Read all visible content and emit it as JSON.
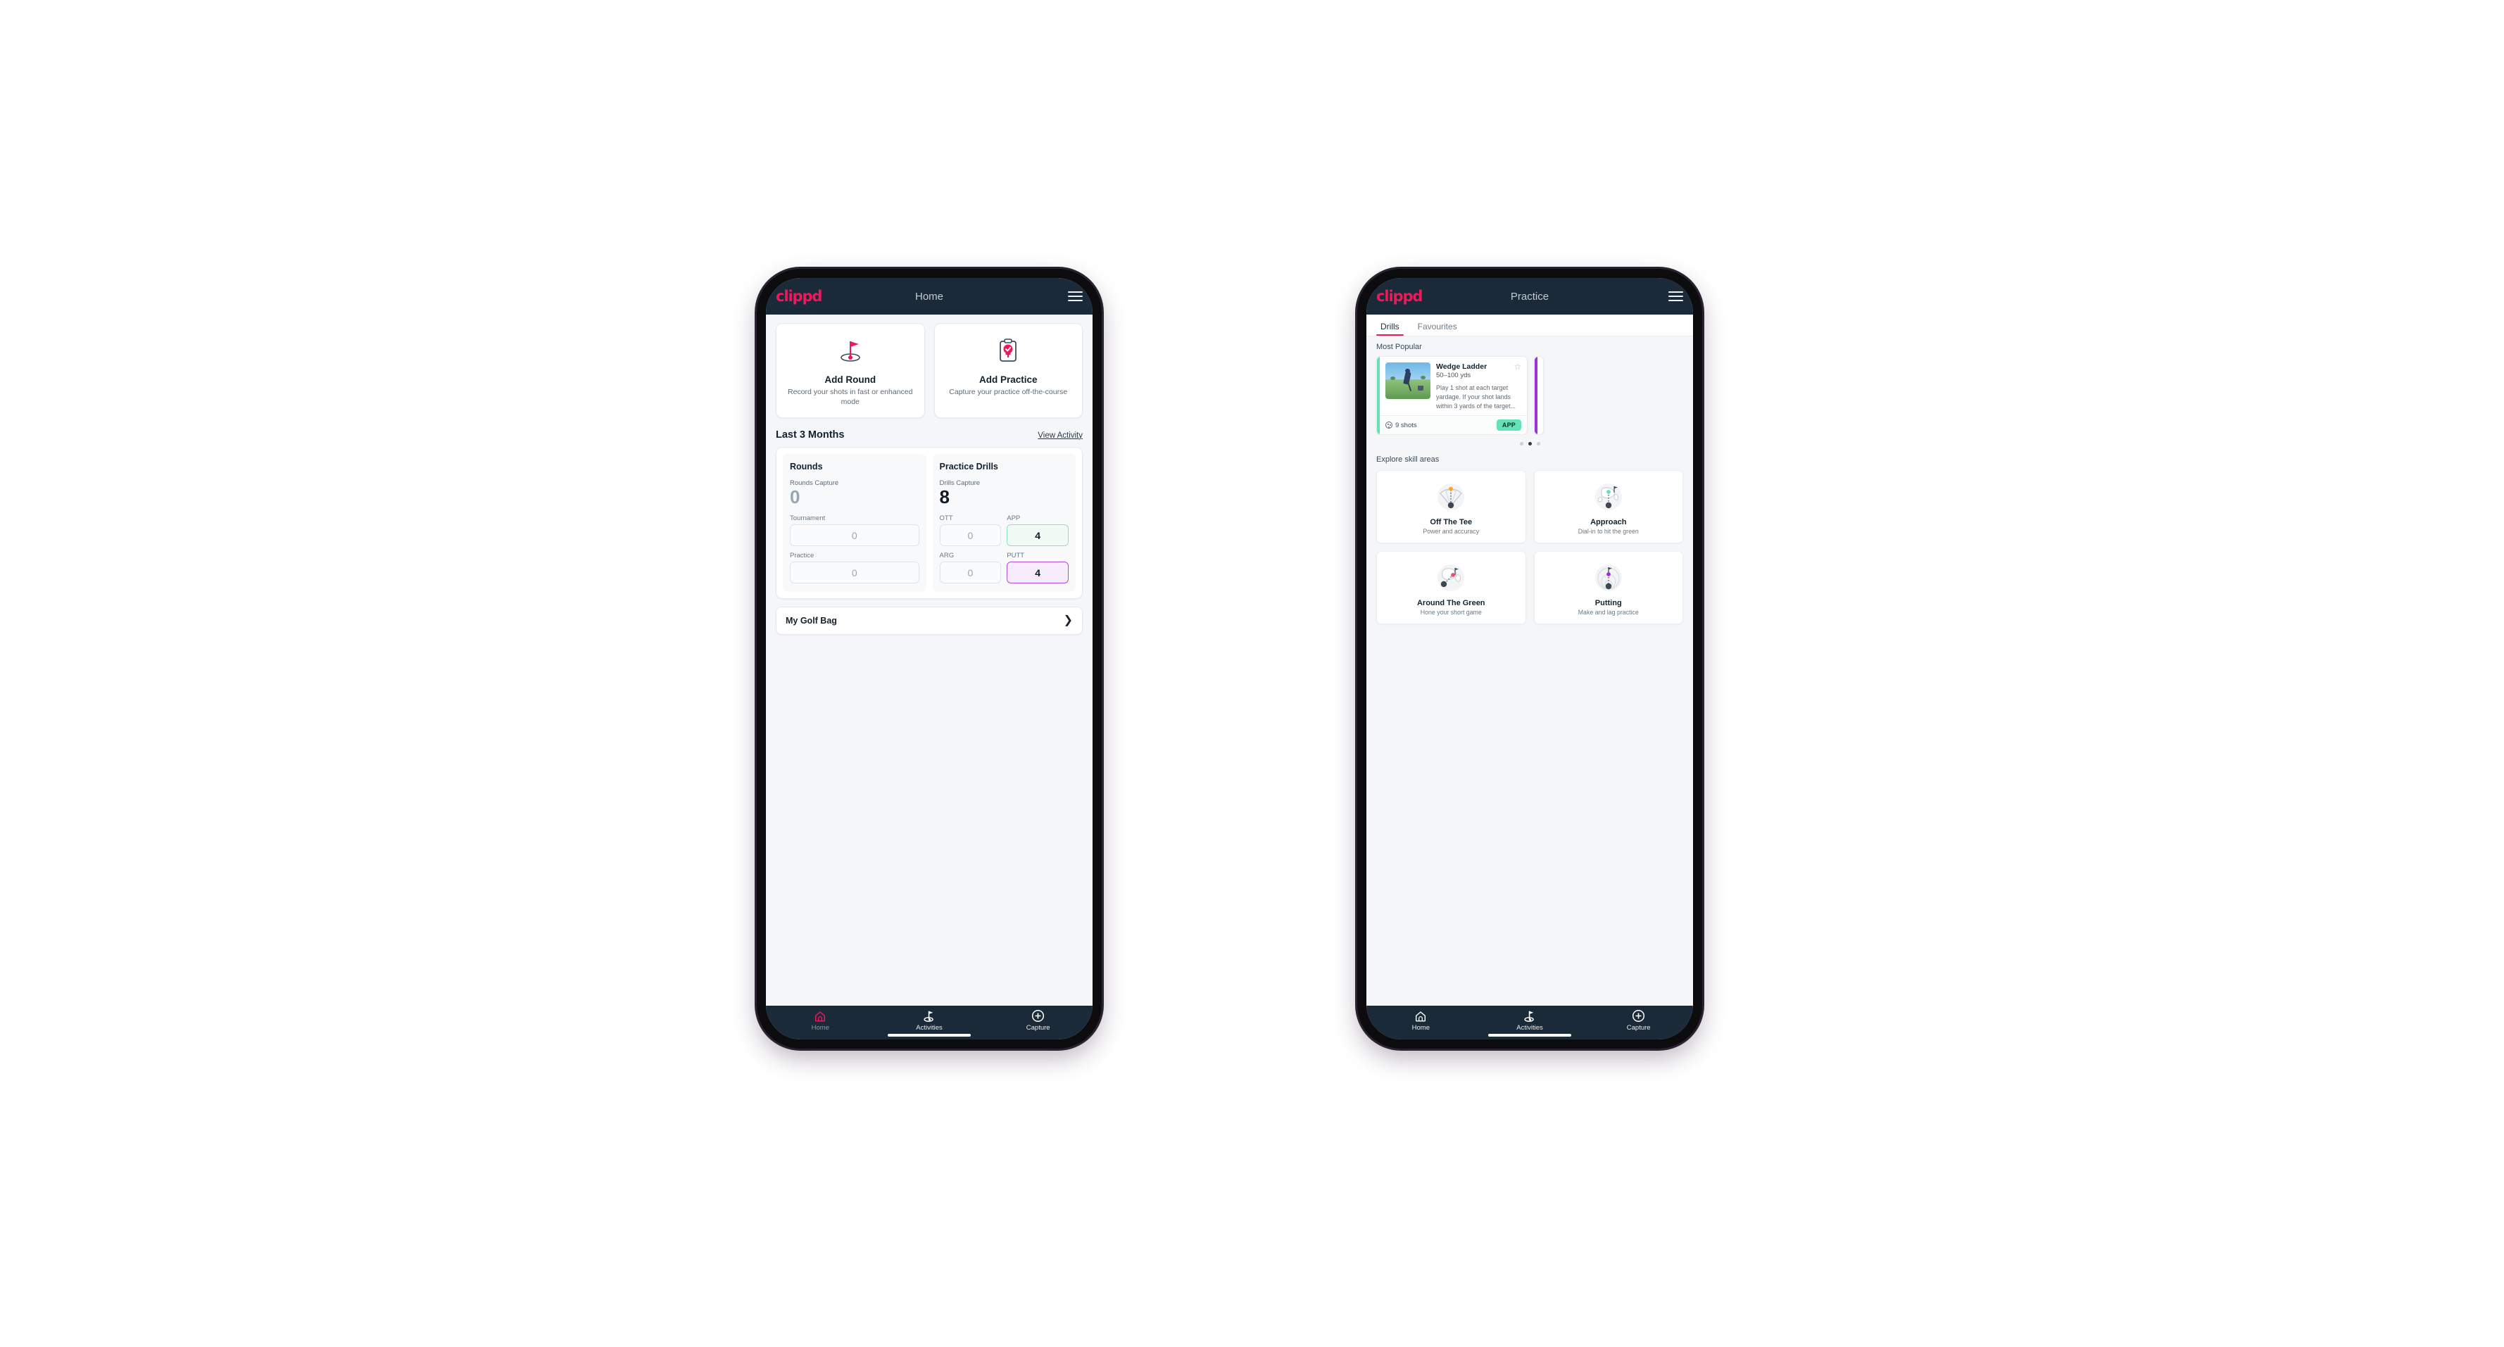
{
  "brand": {
    "logo_text": "clippd",
    "accent_pink": "#ed1a5b",
    "header_navy": "#1b2a38",
    "accent_green": "#63e2b7",
    "accent_purple": "#a32fdb"
  },
  "phone_home": {
    "appbar": {
      "title": "Home",
      "logo": "clippd",
      "menu_icon": "hamburger-icon"
    },
    "quick_actions": [
      {
        "icon": "golf-flag-hole-icon",
        "title": "Add Round",
        "subtitle": "Record your shots in fast or enhanced mode"
      },
      {
        "icon": "clipboard-check-icon",
        "title": "Add Practice",
        "subtitle": "Capture your practice off-the-course"
      }
    ],
    "section": {
      "title": "Last 3 Months",
      "link": "View Activity"
    },
    "stats": {
      "rounds": {
        "title": "Rounds",
        "capture_label": "Rounds Capture",
        "capture_value": "0",
        "fields": [
          {
            "label": "Tournament",
            "value": "0"
          },
          {
            "label": "Practice",
            "value": "0"
          }
        ]
      },
      "practice_drills": {
        "title": "Practice Drills",
        "capture_label": "Drills Capture",
        "capture_value": "8",
        "cells": [
          {
            "label": "OTT",
            "value": "0",
            "accent": "none"
          },
          {
            "label": "APP",
            "value": "4",
            "accent": "green"
          },
          {
            "label": "ARG",
            "value": "0",
            "accent": "none"
          },
          {
            "label": "PUTT",
            "value": "4",
            "accent": "purple"
          }
        ]
      }
    },
    "golf_bag": {
      "label": "My Golf Bag",
      "chevron": "chevron-right-icon"
    },
    "bottom_nav": [
      {
        "icon": "home-icon",
        "label": "Home",
        "active_icon": true,
        "dim_label": true
      },
      {
        "icon": "golf-flag-icon",
        "label": "Activities",
        "active_icon": false,
        "dim_label": false
      },
      {
        "icon": "plus-circle-icon",
        "label": "Capture",
        "active_icon": false,
        "dim_label": false
      }
    ]
  },
  "phone_practice": {
    "appbar": {
      "title": "Practice",
      "logo": "clippd",
      "menu_icon": "hamburger-icon"
    },
    "tabs": [
      {
        "label": "Drills",
        "active": true
      },
      {
        "label": "Favourites",
        "active": false
      }
    ],
    "most_popular_label": "Most Popular",
    "drill": {
      "name": "Wedge Ladder",
      "yardage": "50–100 yds",
      "description": "Play 1 shot at each target yardage. If your shot lands within 3 yards of the target...",
      "shots": "9 shots",
      "badge": "APP",
      "stripe_color": "#63e2b7",
      "star_icon": "star-outline-icon",
      "shots_icon": "golf-ball-icon",
      "thumbnail": "golfer-chipping-photo"
    },
    "carousel_dots": {
      "count": 3,
      "active_index": 1
    },
    "explore_label": "Explore skill areas",
    "skill_areas": [
      {
        "icon": "tee-shot-fan-icon",
        "title": "Off The Tee",
        "subtitle": "Power and accuracy",
        "dot_color": "#f5a623"
      },
      {
        "icon": "green-approach-icon",
        "title": "Approach",
        "subtitle": "Dial-in to hit the green",
        "dot_color": "#63e2b7"
      },
      {
        "icon": "green-chip-icon",
        "title": "Around The Green",
        "subtitle": "Hone your short game",
        "dot_color": "#ed4d6e"
      },
      {
        "icon": "putting-rings-icon",
        "title": "Putting",
        "subtitle": "Make and lag practice",
        "dot_color": "#a32fdb"
      }
    ],
    "bottom_nav": [
      {
        "icon": "home-icon",
        "label": "Home",
        "active_icon": false,
        "dim_label": false
      },
      {
        "icon": "golf-flag-icon",
        "label": "Activities",
        "active_icon": false,
        "dim_label": false
      },
      {
        "icon": "plus-circle-icon",
        "label": "Capture",
        "active_icon": false,
        "dim_label": false
      }
    ]
  }
}
